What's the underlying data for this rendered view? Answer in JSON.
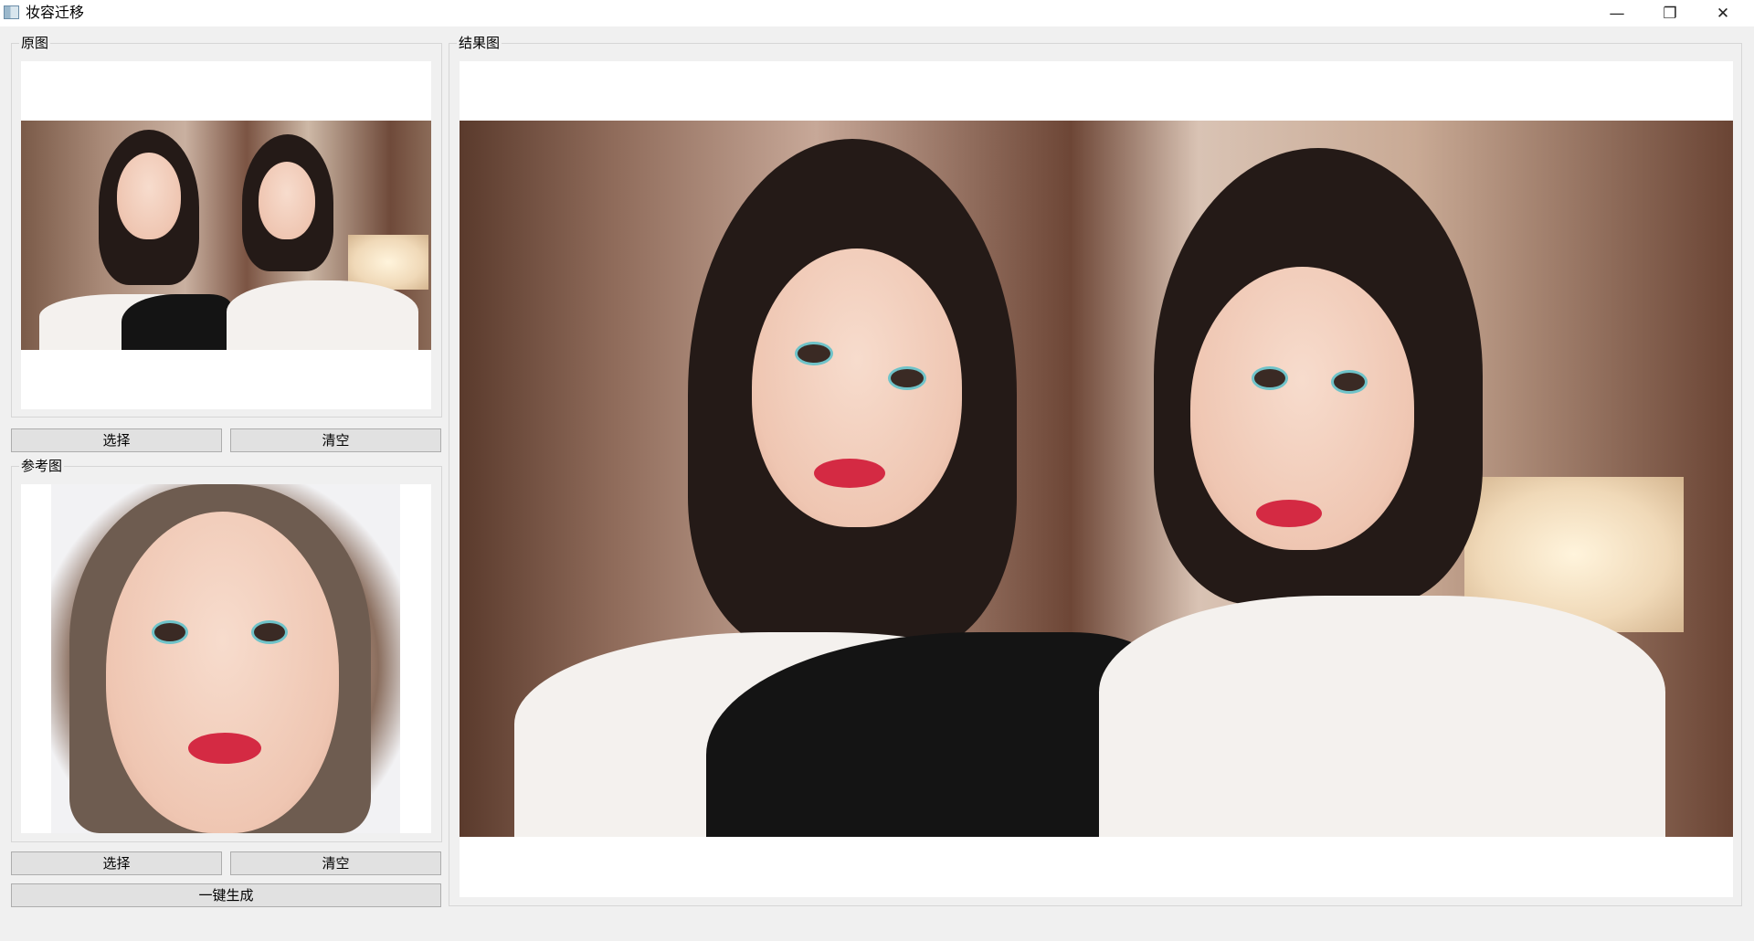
{
  "window": {
    "title": "妆容迁移",
    "app_icon": "image-app-icon",
    "controls": {
      "minimize": "—",
      "maximize": "❐",
      "close": "✕"
    }
  },
  "source_group": {
    "title": "原图",
    "select_label": "选择",
    "clear_label": "清空"
  },
  "reference_group": {
    "title": "参考图",
    "select_label": "选择",
    "clear_label": "清空"
  },
  "generate_label": "一键生成",
  "result_group": {
    "title": "结果图"
  },
  "colors": {
    "window_bg": "#f0f0f0",
    "panel_bg": "#ffffff",
    "button_bg": "#e1e1e1",
    "button_border": "#adadad",
    "group_border": "#d6d6d6"
  }
}
